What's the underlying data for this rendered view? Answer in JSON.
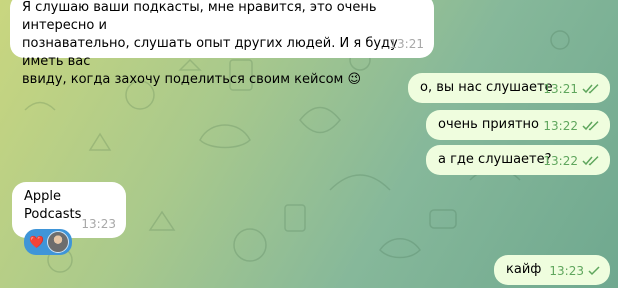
{
  "messages": [
    {
      "text_lines": [
        "Я слушаю ваши подкасты, мне нравится, это очень интересно и",
        "познавательно, слушать опыт других людей. И я буду иметь вас",
        "ввиду, когда захочу поделиться своим кейсом"
      ],
      "emoji": "😉",
      "time": "13:21"
    },
    {
      "text": "о, вы нас слушаете",
      "time": "13:21"
    },
    {
      "text": "очень приятно",
      "time": "13:22"
    },
    {
      "text": "а где слушаете?",
      "time": "13:22"
    },
    {
      "text": "Apple Podcasts",
      "reaction": "❤️",
      "time": "13:23"
    },
    {
      "text": "кайф",
      "time": "13:23"
    }
  ]
}
